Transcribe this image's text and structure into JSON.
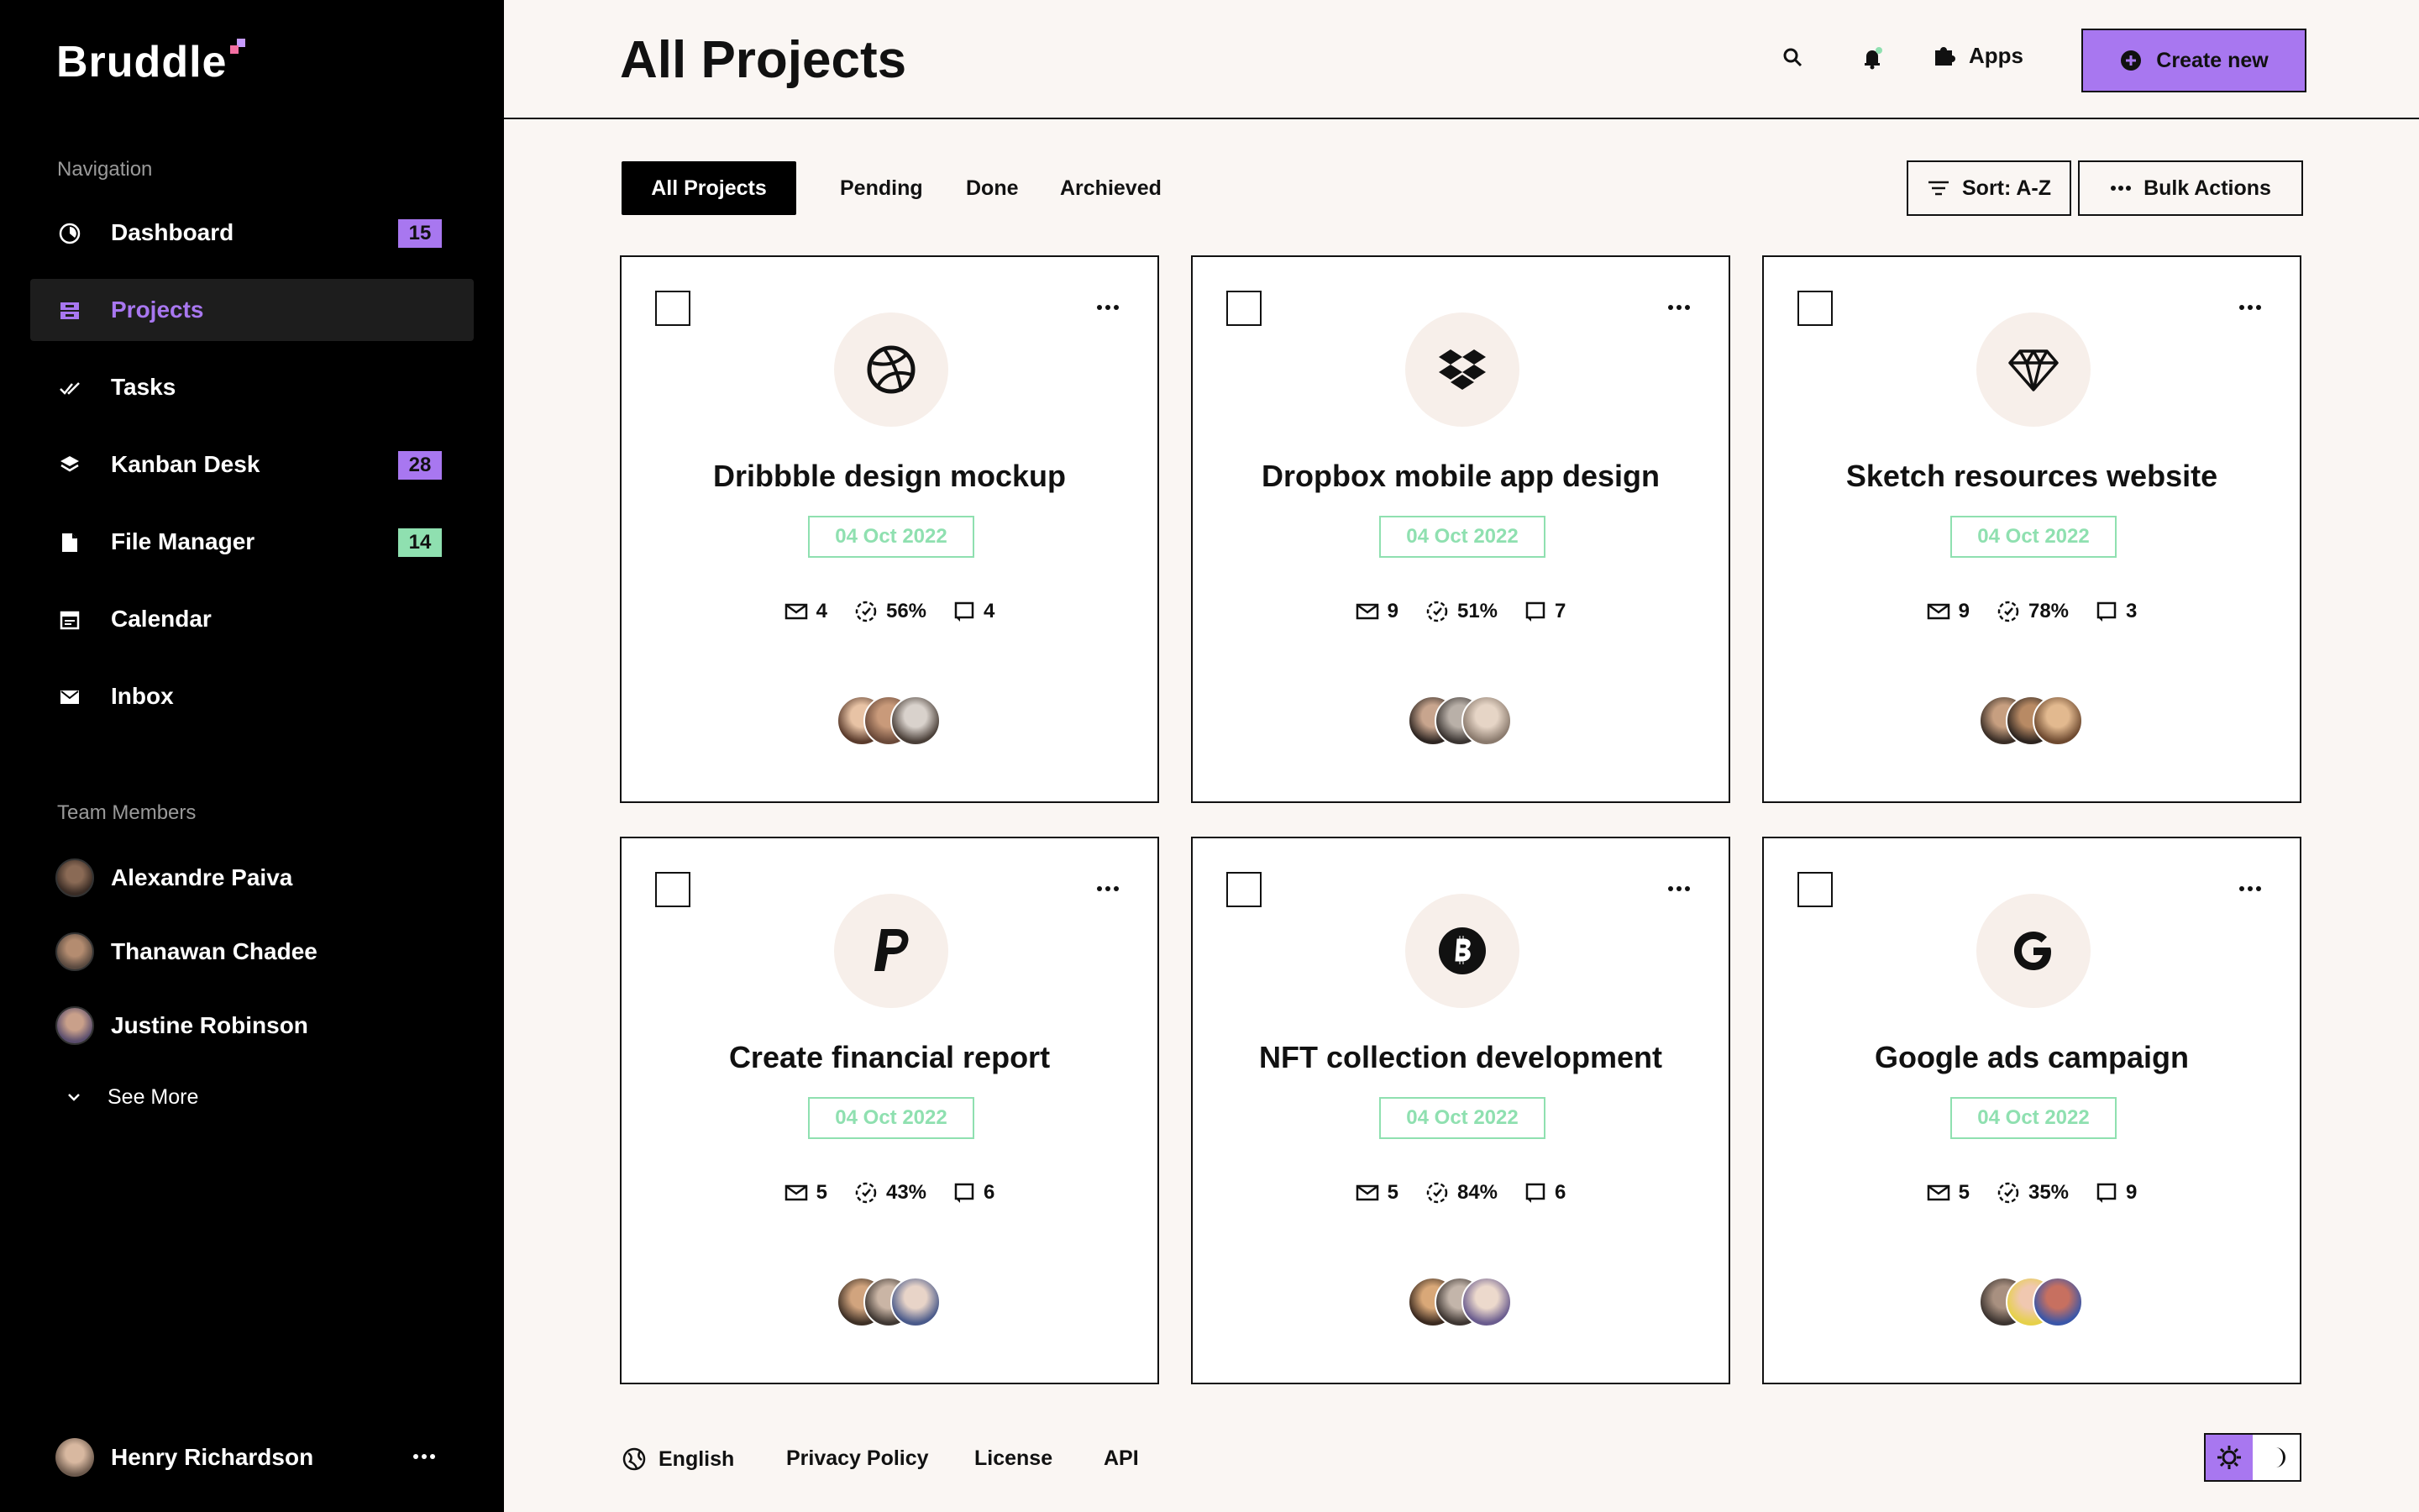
{
  "app": {
    "name": "Bruddle"
  },
  "sidebar": {
    "nav_label": "Navigation",
    "items": [
      {
        "label": "Dashboard",
        "badge": "15",
        "badge_color": "#a877f0",
        "icon": "dashboard-icon"
      },
      {
        "label": "Projects",
        "badge": "",
        "active": true,
        "icon": "projects-icon"
      },
      {
        "label": "Tasks",
        "badge": "",
        "icon": "tasks-icon"
      },
      {
        "label": "Kanban Desk",
        "badge": "28",
        "badge_color": "#a877f0",
        "icon": "kanban-icon"
      },
      {
        "label": "File Manager",
        "badge": "14",
        "badge_color": "#8fe0b0",
        "icon": "file-icon"
      },
      {
        "label": "Calendar",
        "badge": "",
        "icon": "calendar-icon"
      },
      {
        "label": "Inbox",
        "badge": "",
        "icon": "inbox-icon"
      }
    ],
    "team_label": "Team Members",
    "team": [
      {
        "name": "Alexandre Paiva"
      },
      {
        "name": "Thanawan Chadee"
      },
      {
        "name": "Justine Robinson"
      }
    ],
    "see_more": "See More",
    "current_user": {
      "name": "Henry Richardson"
    }
  },
  "header": {
    "title": "All Projects",
    "apps_label": "Apps",
    "create_label": "Create new"
  },
  "filters": {
    "tabs": [
      "All Projects",
      "Pending",
      "Done",
      "Archieved"
    ],
    "sort_label": "Sort: A-Z",
    "bulk_label": "Bulk Actions"
  },
  "projects": [
    {
      "title": "Dribbble design mockup",
      "date": "04 Oct 2022",
      "messages": "4",
      "progress": "56%",
      "tasks": "4",
      "logo": "dribbble-icon"
    },
    {
      "title": "Dropbox mobile app design",
      "date": "04 Oct 2022",
      "messages": "9",
      "progress": "51%",
      "tasks": "7",
      "logo": "dropbox-icon"
    },
    {
      "title": "Sketch resources website",
      "date": "04 Oct 2022",
      "messages": "9",
      "progress": "78%",
      "tasks": "3",
      "logo": "sketch-icon"
    },
    {
      "title": "Create financial report",
      "date": "04 Oct 2022",
      "messages": "5",
      "progress": "43%",
      "tasks": "6",
      "logo": "paypal-icon"
    },
    {
      "title": "NFT collection development",
      "date": "04 Oct 2022",
      "messages": "5",
      "progress": "84%",
      "tasks": "6",
      "logo": "bitcoin-icon"
    },
    {
      "title": "Google ads campaign",
      "date": "04 Oct 2022",
      "messages": "5",
      "progress": "35%",
      "tasks": "9",
      "logo": "google-icon"
    }
  ],
  "footer": {
    "language": "English",
    "privacy": "Privacy Policy",
    "license": "License",
    "api": "API"
  },
  "colors": {
    "accent": "#a877f0",
    "success": "#8fe0b0",
    "background": "#faf6f3"
  }
}
